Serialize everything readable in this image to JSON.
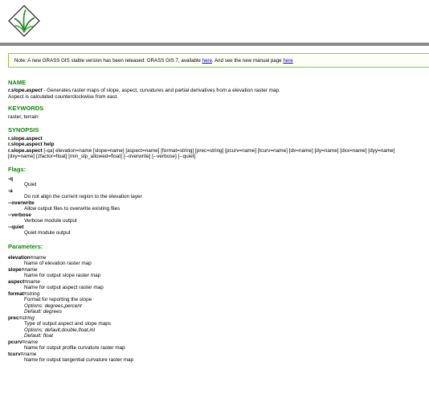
{
  "note": {
    "text_before": "Note: A new GRASS GIS stable version has been released: GRASS GIS 7, available ",
    "link1": "here",
    "text_middle": ". And see the new manual page ",
    "link2": "here"
  },
  "name": {
    "heading": "NAME",
    "cmd": "r.slope.aspect",
    "desc": " - Generates raster maps of slope, aspect, curvatures and partial derivatives from a elevation raster map.",
    "line2": "Aspect is calculated counterclockwise from east."
  },
  "keywords": {
    "heading": "KEYWORDS",
    "text": "raster, terrain"
  },
  "synopsis": {
    "heading": "SYNOPSIS",
    "line1": "r.slope.aspect",
    "line2": "r.slope.aspect help",
    "line3_cmd": "r.slope.aspect",
    "line3_rest": " [-qa] elevation=name [slope=name] [aspect=name] [format=string] [prec=string] [pcurv=name] [tcurv=name] [dx=name] [dy=name] [dxx=name] [dyy=name]",
    "line4": "[dxy=name] [zfactor=float] [min_slp_allowed=float] [--overwrite] [--verbose] [--quiet]"
  },
  "flags": {
    "heading": "Flags:",
    "items": [
      {
        "flag": "-q",
        "desc": "Quiet"
      },
      {
        "flag": "-a",
        "desc": "Do not align the current region to the elevation layer"
      },
      {
        "flag": "--overwrite",
        "desc": "Allow output files to overwrite existing files"
      },
      {
        "flag": "--verbose",
        "desc": "Verbose module output"
      },
      {
        "flag": "--quiet",
        "desc": "Quiet module output"
      }
    ]
  },
  "parameters": {
    "heading": "Parameters:",
    "items": [
      {
        "name": "elevation",
        "type": "name",
        "lines": [
          "Name of elevation raster map"
        ]
      },
      {
        "name": "slope",
        "type": "name",
        "lines": [
          "Name for output slope raster map"
        ]
      },
      {
        "name": "aspect",
        "type": "name",
        "lines": [
          "Name for output aspect raster map"
        ]
      },
      {
        "name": "format",
        "type": "string",
        "lines": [
          "Format for reporting the slope",
          "Options: degrees,percent",
          "Default: degrees"
        ]
      },
      {
        "name": "prec",
        "type": "string",
        "lines": [
          "Type of output aspect and slope maps",
          "Options: default,double,float,int",
          "Default: float"
        ]
      },
      {
        "name": "pcurv",
        "type": "name",
        "lines": [
          "Name for output profile curvature raster map"
        ]
      },
      {
        "name": "tcurv",
        "type": "name",
        "lines": [
          "Name for output tangential curvature raster map"
        ]
      }
    ]
  }
}
